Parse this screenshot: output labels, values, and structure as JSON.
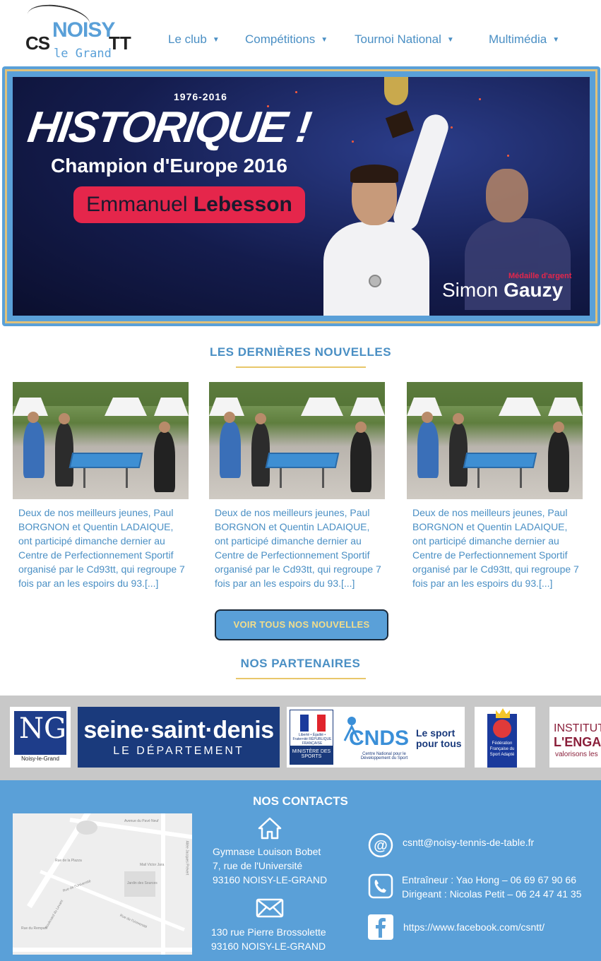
{
  "header": {
    "logo": {
      "cs": "CS",
      "noisy": "NOISY",
      "tt": "TT",
      "grand": "le Grand"
    },
    "nav": [
      {
        "label": "Le club",
        "icon": "caret-down-icon"
      },
      {
        "label": "Compétitions",
        "icon": "caret-down-icon"
      },
      {
        "label": "Tournoi National",
        "icon": "caret-down-icon"
      },
      {
        "label": "Multimédia",
        "icon": "caret-down-icon"
      }
    ]
  },
  "banner": {
    "years": "1976-2016",
    "headline": "HISTORIQUE !",
    "subtitle": "Champion d'Europe  2016",
    "winner_first": "Emmanuel",
    "winner_last": "Lebesson",
    "silver_label": "Médaille d'argent",
    "silver_first": "Simon",
    "silver_last": "Gauzy"
  },
  "news": {
    "title": "LES DERNIÈRES NOUVELLES",
    "items": [
      {
        "text": "Deux de nos meilleurs jeunes, Paul BORGNON et Quentin LADAIQUE, ont participé dimanche dernier au Centre de Perfectionnement Sportif organisé par le Cd93tt, qui regroupe 7 fois par an les espoirs du 93.[...]"
      },
      {
        "text": "Deux de nos meilleurs jeunes, Paul BORGNON et Quentin LADAIQUE, ont participé dimanche dernier au Centre de Perfectionnement Sportif organisé par le Cd93tt, qui regroupe 7 fois par an les espoirs du 93.[...]"
      },
      {
        "text": "Deux de nos meilleurs jeunes, Paul BORGNON et Quentin LADAIQUE, ont participé dimanche dernier au Centre de Perfectionnement Sportif organisé par le Cd93tt, qui regroupe 7 fois par an les espoirs du 93.[...]"
      }
    ],
    "cta_label": "VOIR TOUS NOS NOUVELLES"
  },
  "partners": {
    "title": "NOS PARTENAIRES",
    "noisy": {
      "mark": "NG",
      "caption": "Noisy-le-Grand"
    },
    "ssd": {
      "line1": "seine·saint·denis",
      "line2": "LE DÉPARTEMENT"
    },
    "cnds": {
      "republique": "Liberté • Égalité • Fraternité RÉPUBLIQUE FRANÇAISE",
      "ministere": "MINISTÈRE DES SPORTS",
      "name": "CNDS",
      "slogan1": "Le sport",
      "slogan2": "pour tous",
      "sub": "Centre National pour le Développement du Sport"
    },
    "ffsa": {
      "text": "Fédération Française du Sport Adapté"
    },
    "institut": {
      "l1": "INSTITUT",
      "l2": "L'ENGA",
      "l3": "valorisons les"
    }
  },
  "contacts": {
    "title": "NOS CONTACTS",
    "map_labels": [
      "Avenue du Pavé Neuf",
      "Rue de la Plazza",
      "Rue de l'Université",
      "Rue du Rempart",
      "Rue de l'Université",
      "Mail Victor Jara",
      "Jardin des Sources",
      "Allée Jacques Prévert",
      "Boulevard du Levant"
    ],
    "address1": {
      "l1": "Gymnase Louison Bobet",
      "l2": "7, rue de l'Université",
      "l3": "93160 NOISY-LE-GRAND"
    },
    "address2": {
      "l1": "130 rue Pierre Brossolette",
      "l2": "93160 NOISY-LE-GRAND"
    },
    "email": "csntt@noisy-tennis-de-table.fr",
    "coach": "Entraîneur : Yao Hong – 06 69 67 90 66",
    "manager": "Dirigeant : Nicolas Petit – 06 24 47 41 35",
    "facebook": "https://www.facebook.com/csntt/"
  },
  "colors": {
    "accent": "#5aa0d8",
    "link": "#4a8fc4",
    "gold": "#e8c76a",
    "footer": "#5aa0d8"
  }
}
